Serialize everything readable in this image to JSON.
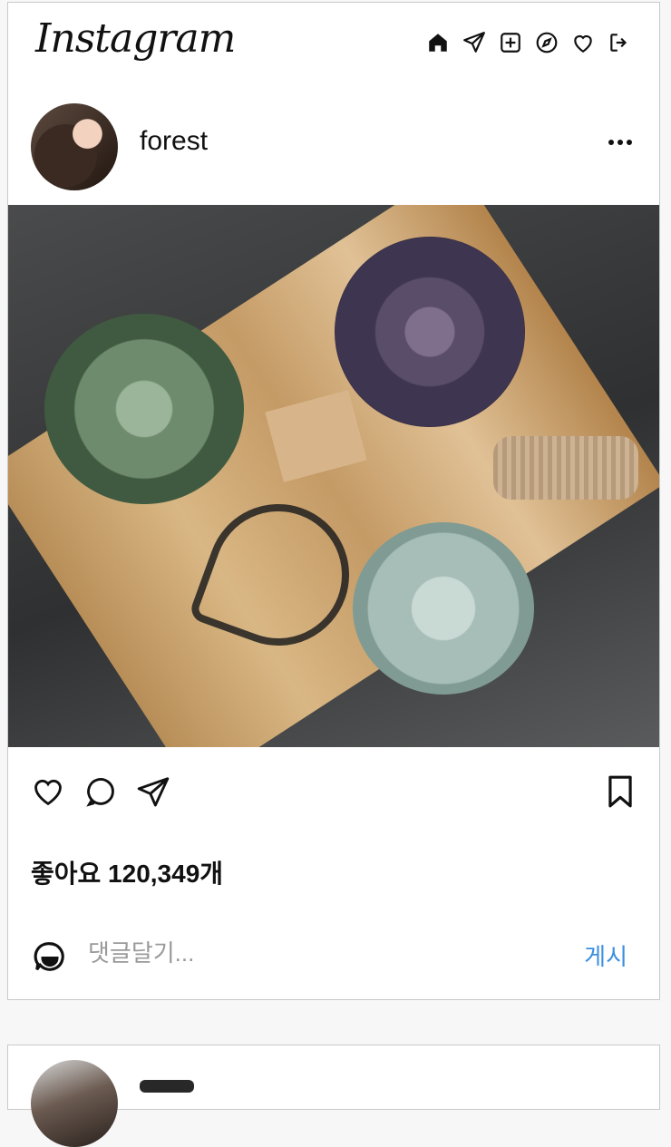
{
  "header": {
    "logo_text": "Instagram",
    "nav_icons": [
      "home-icon",
      "send-icon",
      "add-post-icon",
      "explore-icon",
      "heart-icon",
      "logout-icon"
    ]
  },
  "post": {
    "username": "forest",
    "likes_text": "좋아요 120,349개",
    "comment_placeholder": "댓글달기...",
    "post_button": "게시",
    "colors": {
      "link_blue": "#3b8fe0",
      "placeholder": "#9a9a9a",
      "border": "#c9c9c9"
    }
  }
}
